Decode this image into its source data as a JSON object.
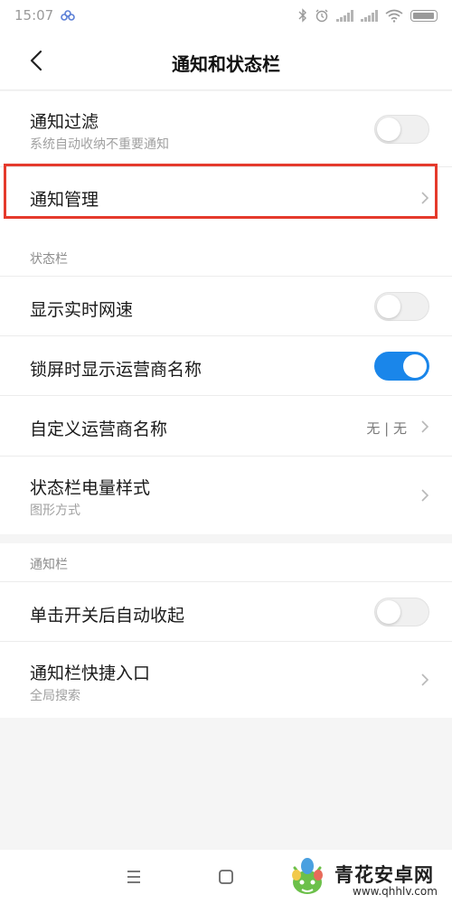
{
  "status_bar": {
    "time": "15:07",
    "icons": [
      "app-icon",
      "bluetooth-icon",
      "alarm-icon",
      "signal-icon",
      "signal-icon",
      "wifi-icon",
      "battery-icon"
    ]
  },
  "header": {
    "title": "通知和状态栏",
    "back_icon": "back-arrow-icon"
  },
  "notification_section": {
    "filter": {
      "title": "通知过滤",
      "subtitle": "系统自动收纳不重要通知",
      "enabled": false
    },
    "manage": {
      "title": "通知管理",
      "highlighted": true
    }
  },
  "status_section": {
    "header": "状态栏",
    "realtime_speed": {
      "title": "显示实时网速",
      "enabled": false
    },
    "lock_carrier": {
      "title": "锁屏时显示运营商名称",
      "enabled": true
    },
    "custom_carrier": {
      "title": "自定义运营商名称",
      "value": "无 | 无"
    },
    "battery_style": {
      "title": "状态栏电量样式",
      "subtitle": "图形方式"
    }
  },
  "notification_bar_section": {
    "header": "通知栏",
    "auto_collapse": {
      "title": "单击开关后自动收起",
      "enabled": false
    },
    "shortcut": {
      "title": "通知栏快捷入口",
      "subtitle": "全局搜索"
    }
  },
  "bottom_nav": {
    "icons": [
      "menu-icon",
      "home-icon"
    ]
  },
  "watermark": {
    "text": "青花安卓网",
    "url": "www.qhhlv.com"
  },
  "colors": {
    "accent": "#1a86ea",
    "highlight_border": "#e53a2c",
    "background": "#f5f5f5"
  }
}
